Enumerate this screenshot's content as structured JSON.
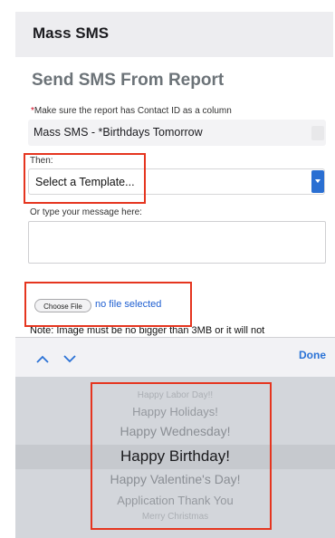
{
  "header": {
    "title": "Mass SMS"
  },
  "form": {
    "title": "Send SMS From Report",
    "required_star": "*",
    "required_note": "Make sure the report has Contact ID as a column",
    "report_select_value": "Mass SMS - *Birthdays Tomorrow",
    "then_label": "Then:",
    "template_select_value": "Select a Template...",
    "message_label": "Or type your message here:",
    "message_value": "",
    "choose_file_label": "Choose File",
    "file_status": "no file selected",
    "note_text": "Note: Image must be no bigger than 3MB or it will not"
  },
  "toolbar": {
    "prev_icon": "chevron-up-icon",
    "next_icon": "chevron-down-icon",
    "done_label": "Done"
  },
  "picker": {
    "items": [
      "Happy Labor Day!!",
      "Happy Holidays!",
      "Happy Wednesday!",
      "Happy Birthday!",
      "Happy Valentine's Day!",
      "Application Thank You",
      "Merry Christmas"
    ],
    "selected": "Happy Birthday!"
  },
  "colors": {
    "accent": "#2a72d6",
    "highlight": "#e5351f",
    "title_gray": "#6c7378"
  }
}
